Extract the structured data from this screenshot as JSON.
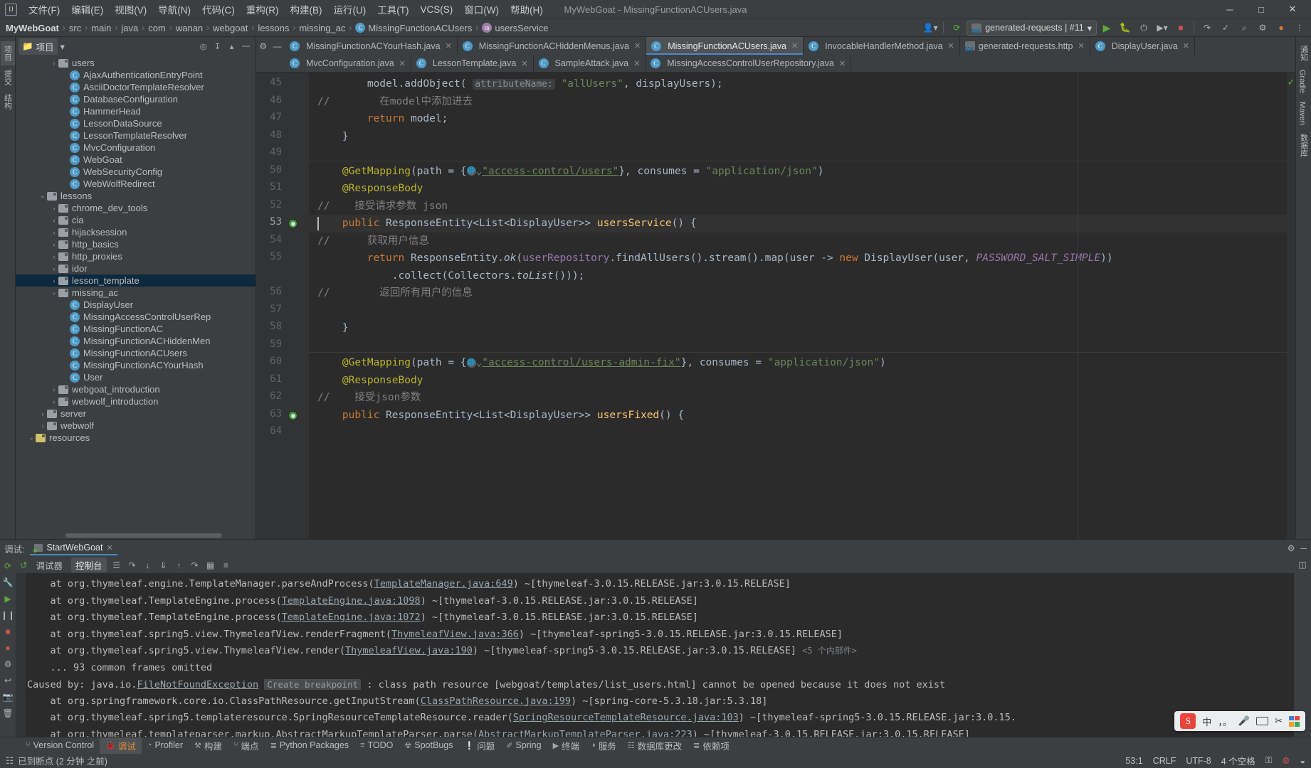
{
  "window": {
    "title": "MyWebGoat - MissingFunctionACUsers.java",
    "minimize": "─",
    "maximize": "□",
    "close": "✕",
    "logo": "IJ"
  },
  "menu": [
    "文件(F)",
    "编辑(E)",
    "视图(V)",
    "导航(N)",
    "代码(C)",
    "重构(R)",
    "构建(B)",
    "运行(U)",
    "工具(T)",
    "VCS(S)",
    "窗口(W)",
    "帮助(H)"
  ],
  "breadcrumb": {
    "items": [
      "MyWebGoat",
      "src",
      "main",
      "java",
      "com",
      "wanan",
      "webgoat",
      "lessons",
      "missing_ac",
      "MissingFunctionACUsers",
      "usersService"
    ],
    "separator": "›"
  },
  "toolbar": {
    "run_config": "generated-requests | #11",
    "dropdown_caret": "▾",
    "run": "▶",
    "debug": "☼",
    "profile": "⟳",
    "stop": "■",
    "search": "⌕",
    "settings": "⚙",
    "account": "●"
  },
  "project_panel": {
    "title": "项目",
    "caret": "▾",
    "tools": [
      "⊕",
      "↧",
      "▴",
      "─"
    ],
    "tree": [
      {
        "indent": 3,
        "arrow": "›",
        "icon": "folder",
        "label": "users"
      },
      {
        "indent": 4,
        "arrow": "",
        "icon": "class",
        "label": "AjaxAuthenticationEntryPoint"
      },
      {
        "indent": 4,
        "arrow": "",
        "icon": "class",
        "label": "AsciiDoctorTemplateResolver"
      },
      {
        "indent": 4,
        "arrow": "",
        "icon": "class",
        "label": "DatabaseConfiguration"
      },
      {
        "indent": 4,
        "arrow": "",
        "icon": "class",
        "label": "HammerHead"
      },
      {
        "indent": 4,
        "arrow": "",
        "icon": "class",
        "label": "LessonDataSource"
      },
      {
        "indent": 4,
        "arrow": "",
        "icon": "class",
        "label": "LessonTemplateResolver"
      },
      {
        "indent": 4,
        "arrow": "",
        "icon": "class",
        "label": "MvcConfiguration"
      },
      {
        "indent": 4,
        "arrow": "",
        "icon": "class-run",
        "label": "WebGoat"
      },
      {
        "indent": 4,
        "arrow": "",
        "icon": "class",
        "label": "WebSecurityConfig"
      },
      {
        "indent": 4,
        "arrow": "",
        "icon": "class",
        "label": "WebWolfRedirect"
      },
      {
        "indent": 2,
        "arrow": "⌄",
        "icon": "folder",
        "label": "lessons"
      },
      {
        "indent": 3,
        "arrow": "›",
        "icon": "folder",
        "label": "chrome_dev_tools"
      },
      {
        "indent": 3,
        "arrow": "›",
        "icon": "folder",
        "label": "cia"
      },
      {
        "indent": 3,
        "arrow": "›",
        "icon": "folder",
        "label": "hijacksession"
      },
      {
        "indent": 3,
        "arrow": "›",
        "icon": "folder",
        "label": "http_basics"
      },
      {
        "indent": 3,
        "arrow": "›",
        "icon": "folder",
        "label": "http_proxies"
      },
      {
        "indent": 3,
        "arrow": "›",
        "icon": "folder",
        "label": "idor"
      },
      {
        "indent": 3,
        "arrow": "›",
        "icon": "folder",
        "label": "lesson_template",
        "selected": true
      },
      {
        "indent": 3,
        "arrow": "⌄",
        "icon": "folder",
        "label": "missing_ac"
      },
      {
        "indent": 4,
        "arrow": "",
        "icon": "class",
        "label": "DisplayUser"
      },
      {
        "indent": 4,
        "arrow": "",
        "icon": "class",
        "label": "MissingAccessControlUserRep"
      },
      {
        "indent": 4,
        "arrow": "",
        "icon": "class",
        "label": "MissingFunctionAC"
      },
      {
        "indent": 4,
        "arrow": "",
        "icon": "class",
        "label": "MissingFunctionACHiddenMen"
      },
      {
        "indent": 4,
        "arrow": "",
        "icon": "class",
        "label": "MissingFunctionACUsers"
      },
      {
        "indent": 4,
        "arrow": "",
        "icon": "class",
        "label": "MissingFunctionACYourHash"
      },
      {
        "indent": 4,
        "arrow": "",
        "icon": "class",
        "label": "User"
      },
      {
        "indent": 3,
        "arrow": "›",
        "icon": "folder",
        "label": "webgoat_introduction"
      },
      {
        "indent": 3,
        "arrow": "›",
        "icon": "folder",
        "label": "webwolf_introduction"
      },
      {
        "indent": 2,
        "arrow": "›",
        "icon": "folder",
        "label": "server"
      },
      {
        "indent": 2,
        "arrow": "›",
        "icon": "folder",
        "label": "webwolf"
      },
      {
        "indent": 1,
        "arrow": "⌄",
        "icon": "resources",
        "label": "resources"
      }
    ]
  },
  "editor_tabs": {
    "row1": [
      {
        "label": "MissingFunctionACYourHash.java",
        "icon": "class",
        "active": false
      },
      {
        "label": "MissingFunctionACHiddenMenus.java",
        "icon": "class",
        "active": false
      },
      {
        "label": "MissingFunctionACUsers.java",
        "icon": "class",
        "active": true
      },
      {
        "label": "InvocableHandlerMethod.java",
        "icon": "class",
        "active": false
      },
      {
        "label": "generated-requests.http",
        "icon": "http",
        "active": false
      },
      {
        "label": "DisplayUser.java",
        "icon": "class",
        "active": false
      }
    ],
    "row2": [
      {
        "label": "MvcConfiguration.java",
        "icon": "class",
        "active": false
      },
      {
        "label": "LessonTemplate.java",
        "icon": "class",
        "active": false
      },
      {
        "label": "SampleAttack.java",
        "icon": "class",
        "active": false
      },
      {
        "label": "MissingAccessControlUserRepository.java",
        "icon": "class",
        "active": false
      }
    ],
    "close_glyph": "✕"
  },
  "code": {
    "line_numbers": [
      "45",
      "46",
      "47",
      "48",
      "49",
      "50",
      "51",
      "52",
      "53",
      "54",
      "55",
      "56",
      "57",
      "58",
      "59",
      "60",
      "61",
      "62",
      "63",
      "64"
    ],
    "current_line": "53",
    "breakpoint_lines": [
      "53",
      "63"
    ],
    "lines": [
      {
        "n": "45",
        "text": "        model.addObject( attributeName: \"allUsers\", displayUsers);"
      },
      {
        "n": "46",
        "text": "//        在model中添加进去"
      },
      {
        "n": "47",
        "text": "        return model;"
      },
      {
        "n": "48",
        "text": "    }"
      },
      {
        "n": "49",
        "text": ""
      },
      {
        "n": "50",
        "text": "    @GetMapping(path = {\"access-control/users\"}, consumes = \"application/json\")"
      },
      {
        "n": "51",
        "text": "    @ResponseBody"
      },
      {
        "n": "52",
        "text": "//    接受请求参数 json"
      },
      {
        "n": "53",
        "text": "    public ResponseEntity<List<DisplayUser>> usersService() {"
      },
      {
        "n": "54",
        "text": "//      获取用户信息"
      },
      {
        "n": "55",
        "text": "        return ResponseEntity.ok(userRepository.findAllUsers().stream().map(user -> new DisplayUser(user, PASSWORD_SALT_SIMPLE))"
      },
      {
        "n": "55b",
        "text": "            .collect(Collectors.toList()));"
      },
      {
        "n": "56",
        "text": "//        返回所有用户的信息"
      },
      {
        "n": "57",
        "text": ""
      },
      {
        "n": "58",
        "text": "    }"
      },
      {
        "n": "59",
        "text": ""
      },
      {
        "n": "60",
        "text": "    @GetMapping(path = {\"access-control/users-admin-fix\"}, consumes = \"application/json\")"
      },
      {
        "n": "61",
        "text": "    @ResponseBody"
      },
      {
        "n": "62",
        "text": "//    接受json参数"
      },
      {
        "n": "63",
        "text": "    public ResponseEntity<List<DisplayUser>> usersFixed() {"
      },
      {
        "n": "64",
        "text": ""
      }
    ],
    "param_hint_1": "attributeName:",
    "url_1": "access-control/users",
    "url_2": "access-control/users-admin-fix"
  },
  "debug_panel": {
    "label": "调试:",
    "session_tab": "StartWebGoat",
    "close_glyph": "✕",
    "settings_glyph": "⚙",
    "minimize_glyph": "─",
    "tabs": [
      {
        "label": "调试器",
        "selected": false
      },
      {
        "label": "控制台",
        "selected": true
      }
    ],
    "toolbar_icons": [
      "☰",
      "↱",
      "↓",
      "⤓",
      "⤒",
      "⤴",
      "▦",
      "≡"
    ],
    "console_lines": [
      {
        "pre": "    at org.thymeleaf.engine.TemplateManager.parseAndProcess(",
        "link": "TemplateManager.java:649",
        "post": ") ~[thymeleaf-3.0.15.RELEASE.jar:3.0.15.RELEASE]"
      },
      {
        "pre": "    at org.thymeleaf.TemplateEngine.process(",
        "link": "TemplateEngine.java:1098",
        "post": ") ~[thymeleaf-3.0.15.RELEASE.jar:3.0.15.RELEASE]"
      },
      {
        "pre": "    at org.thymeleaf.TemplateEngine.process(",
        "link": "TemplateEngine.java:1072",
        "post": ") ~[thymeleaf-3.0.15.RELEASE.jar:3.0.15.RELEASE]"
      },
      {
        "pre": "    at org.thymeleaf.spring5.view.ThymeleafView.renderFragment(",
        "link": "ThymeleafView.java:366",
        "post": ") ~[thymeleaf-spring5-3.0.15.RELEASE.jar:3.0.15.RELEASE]"
      },
      {
        "pre": "    at org.thymeleaf.spring5.view.ThymeleafView.render(",
        "link": "ThymeleafView.java:190",
        "post": ") ~[thymeleaf-spring5-3.0.15.RELEASE.jar:3.0.15.RELEASE]",
        "extra": "<5 个内部件>"
      },
      {
        "pre": "    ... 93 common frames omitted",
        "link": "",
        "post": ""
      },
      {
        "pre": "Caused by: java.io.",
        "link": "FileNotFoundException",
        "hint": "Create breakpoint",
        "post": ": class path resource [webgoat/templates/list_users.html] cannot be opened because it does not exist"
      },
      {
        "pre": "    at org.springframework.core.io.ClassPathResource.getInputStream(",
        "link": "ClassPathResource.java:199",
        "post": ") ~[spring-core-5.3.18.jar:5.3.18]"
      },
      {
        "pre": "    at org.thymeleaf.spring5.templateresource.SpringResourceTemplateResource.reader(",
        "link": "SpringResourceTemplateResource.java:103",
        "post": ") ~[thymeleaf-spring5-3.0.15.RELEASE.jar:3.0.15."
      },
      {
        "pre": "    at org.thymeleaf.templateparser.markup.AbstractMarkupTemplateParser.parse(",
        "link": "AbstractMarkupTemplateParser.java:223",
        "post": ") ~[thymeleaf-3.0.15.RELEASE.jar:3.0.15.RELEASE]"
      }
    ]
  },
  "left_strip": [
    {
      "label": "项目",
      "selected": true
    },
    {
      "label": "提交"
    },
    {
      "label": "结构"
    }
  ],
  "right_strip": [
    "通知",
    "Gradle",
    "Maven",
    "数据库"
  ],
  "debug_left_strip": [
    "Bookmarks",
    "Structure"
  ],
  "bottom_tabs": [
    {
      "icon": "⑂",
      "label": "Version Control",
      "selected": false
    },
    {
      "icon": "🐞",
      "label": "调试",
      "selected": true
    },
    {
      "icon": "◔",
      "label": "Profiler",
      "selected": false
    },
    {
      "icon": "⚒",
      "label": "构建",
      "selected": false
    },
    {
      "icon": "⑂",
      "label": "端点",
      "selected": false
    },
    {
      "icon": "≣",
      "label": "Python Packages",
      "selected": false
    },
    {
      "icon": "≡",
      "label": "TODO",
      "selected": false
    },
    {
      "icon": "☢",
      "label": "SpotBugs",
      "selected": false
    },
    {
      "icon": "❕",
      "label": "问题",
      "selected": false
    },
    {
      "icon": "✐",
      "label": "Spring",
      "selected": false
    },
    {
      "icon": "▶",
      "label": "终端",
      "selected": false
    },
    {
      "icon": "◑",
      "label": "服务",
      "selected": false
    },
    {
      "icon": "☷",
      "label": "数据库更改",
      "selected": false
    },
    {
      "icon": "≣",
      "label": "依赖项",
      "selected": false
    }
  ],
  "status": {
    "message_icon": "☷",
    "message": "已到断点 (2 分钟 之前)",
    "caret_position": "53:1",
    "line_separator": "CRLF",
    "encoding": "UTF-8",
    "indent": "4 个空格",
    "lock_icon": "⚿",
    "inspection_icon": "☢",
    "notification_icon": "◒"
  },
  "ime": {
    "logo": "S",
    "mode": "中",
    "punct": "，。",
    "mic": "🎤",
    "keyboard": "keyboard",
    "clip": "✂",
    "grid": "grid"
  },
  "colors": {
    "accent": "#4a88c7",
    "editor_bg": "#2b2b2b",
    "panel_bg": "#3c3f41",
    "selection": "#0d293e",
    "string": "#6a8759",
    "keyword": "#cc7832",
    "annotation": "#bbb529",
    "field": "#9876aa",
    "method": "#ffc66d",
    "comment": "#808080"
  }
}
